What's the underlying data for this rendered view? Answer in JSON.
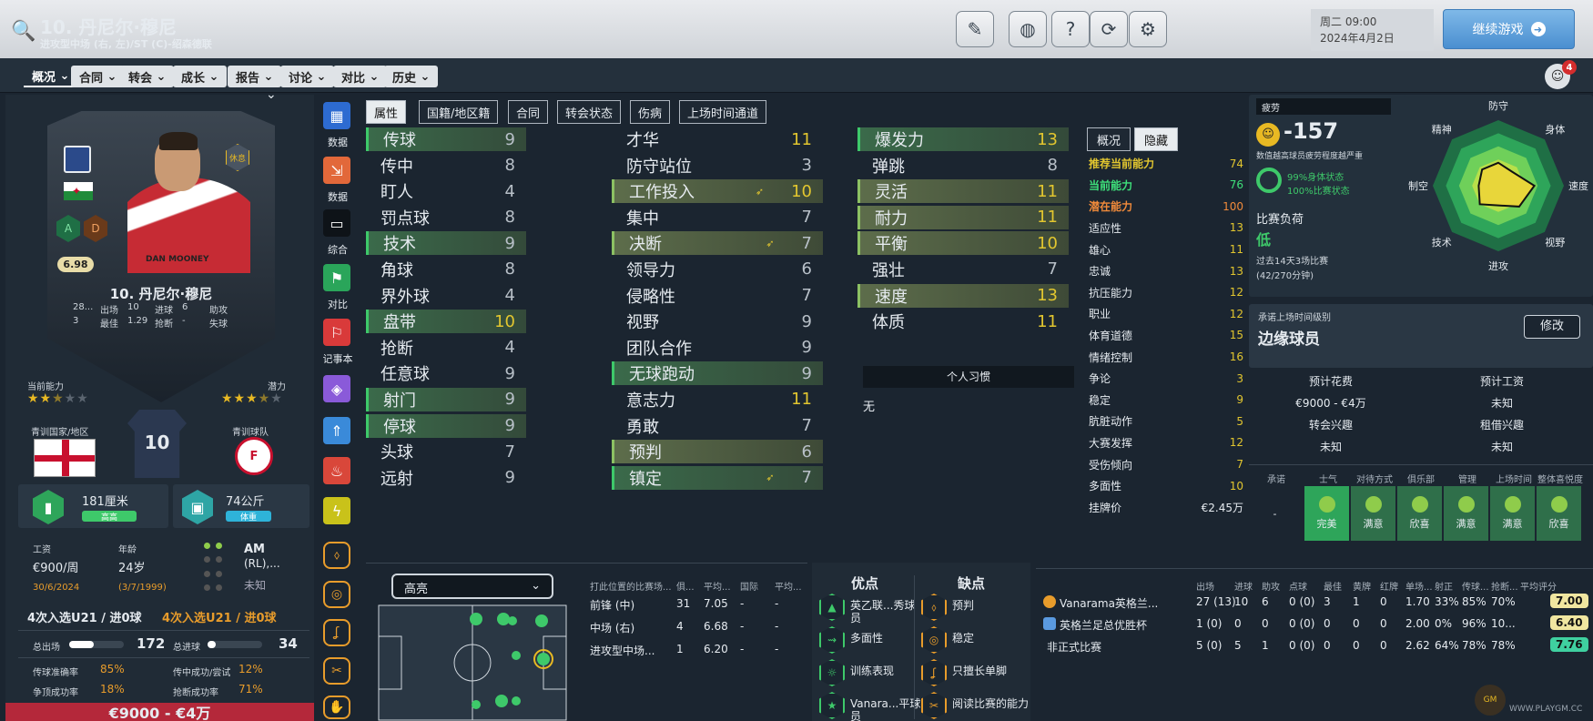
{
  "header": {
    "title": "10. 丹尼尔·穆尼",
    "subtitle": "进攻型中场 (右, 左)/ST (C)-绍森德联",
    "datetime_day": "周二 09:00",
    "datetime_date": "2024年4月2日",
    "continue_label": "继续游戏"
  },
  "nav": {
    "tabs": [
      "概况",
      "合同",
      "转会",
      "成长",
      "报告",
      "讨论",
      "对比",
      "历史"
    ],
    "notifications": "4"
  },
  "card": {
    "rest_badge": "休息",
    "rating": "6.98",
    "name": "10. 丹尼尔·穆尼",
    "jersey_name": "DAN MOONEY",
    "stats_row1": [
      "28...",
      "出场",
      "10",
      "进球",
      "6",
      "助攻"
    ],
    "stats_row2": [
      "3",
      "最佳",
      "1.29",
      "抢断",
      "-",
      "失球"
    ],
    "current_ability_label": "当前能力",
    "potential_label": "潜力",
    "current_stars": 2.5,
    "potential_stars": 3.5,
    "badge_a": "A",
    "badge_d": "D"
  },
  "profile": {
    "youth_nation_label": "青训国家/地区",
    "youth_club_label": "青训球队",
    "shirt_number": "10",
    "height": "181厘米",
    "height_tag": "高高",
    "weight": "74公斤",
    "weight_tag": "体重",
    "wage_label": "工资",
    "wage": "€900/周",
    "age_label": "年龄",
    "age": "24岁",
    "contract_end": "30/6/2024",
    "dob": "(3/7/1999)",
    "position_main": "AM",
    "position_sub": "(RL),...",
    "position_status": "未知",
    "u21_left": "4次入选U21 / 进0球",
    "u21_right": "4次入选U21 / 进0球",
    "appearances_label": "总出场",
    "appearances": "172",
    "goals_label": "总进球",
    "goals": "34",
    "pass_label": "传球准确率",
    "pass_value": "85%",
    "cross_label": "传中成功/尝试",
    "cross_value": "12%",
    "header_label": "争顶成功率",
    "header_value": "18%",
    "tackle_label": "抢断成功率",
    "tackle_value": "71%",
    "value_range": "€9000 - €4万"
  },
  "side_buttons": [
    "数据",
    "数据",
    "综合",
    "对比",
    "记事本"
  ],
  "attr_tabs": [
    "属性",
    "国籍/地区籍",
    "合同",
    "转会状态",
    "伤病",
    "上场时间通道"
  ],
  "technical": [
    {
      "name": "传球",
      "value": "9",
      "hl": "hl"
    },
    {
      "name": "传中",
      "value": "8",
      "hl": ""
    },
    {
      "name": "盯人",
      "value": "4",
      "hl": ""
    },
    {
      "name": "罚点球",
      "value": "8",
      "hl": ""
    },
    {
      "name": "技术",
      "value": "9",
      "hl": "hl"
    },
    {
      "name": "角球",
      "value": "8",
      "hl": ""
    },
    {
      "name": "界外球",
      "value": "4",
      "hl": ""
    },
    {
      "name": "盘带",
      "value": "10",
      "hl": "hl"
    },
    {
      "name": "抢断",
      "value": "4",
      "hl": ""
    },
    {
      "name": "任意球",
      "value": "9",
      "hl": ""
    },
    {
      "name": "射门",
      "value": "9",
      "hl": "hl"
    },
    {
      "name": "停球",
      "value": "9",
      "hl": "hl"
    },
    {
      "name": "头球",
      "value": "7",
      "hl": ""
    },
    {
      "name": "远射",
      "value": "9",
      "hl": ""
    }
  ],
  "mental": [
    {
      "name": "才华",
      "value": "11",
      "hl": "",
      "arrow": ""
    },
    {
      "name": "防守站位",
      "value": "3",
      "hl": "",
      "arrow": ""
    },
    {
      "name": "工作投入",
      "value": "10",
      "hl": "hl2",
      "arrow": "➶"
    },
    {
      "name": "集中",
      "value": "7",
      "hl": "",
      "arrow": ""
    },
    {
      "name": "决断",
      "value": "7",
      "hl": "hl2",
      "arrow": "➶"
    },
    {
      "name": "领导力",
      "value": "6",
      "hl": "",
      "arrow": ""
    },
    {
      "name": "侵略性",
      "value": "7",
      "hl": "",
      "arrow": ""
    },
    {
      "name": "视野",
      "value": "9",
      "hl": "",
      "arrow": ""
    },
    {
      "name": "团队合作",
      "value": "9",
      "hl": "",
      "arrow": ""
    },
    {
      "name": "无球跑动",
      "value": "9",
      "hl": "hl",
      "arrow": ""
    },
    {
      "name": "意志力",
      "value": "11",
      "hl": "",
      "arrow": ""
    },
    {
      "name": "勇敢",
      "value": "7",
      "hl": "",
      "arrow": ""
    },
    {
      "name": "预判",
      "value": "6",
      "hl": "hl2",
      "arrow": ""
    },
    {
      "name": "镇定",
      "value": "7",
      "hl": "hl",
      "arrow": "➶"
    }
  ],
  "physical": [
    {
      "name": "爆发力",
      "value": "13",
      "hl": "hl"
    },
    {
      "name": "弹跳",
      "value": "8",
      "hl": ""
    },
    {
      "name": "灵活",
      "value": "11",
      "hl": "hl2"
    },
    {
      "name": "耐力",
      "value": "11",
      "hl": "hl2"
    },
    {
      "name": "平衡",
      "value": "10",
      "hl": "hl2"
    },
    {
      "name": "强壮",
      "value": "7",
      "hl": ""
    },
    {
      "name": "速度",
      "value": "13",
      "hl": "hl2"
    },
    {
      "name": "体质",
      "value": "11",
      "hl": ""
    }
  ],
  "habits": {
    "title": "个人习惯",
    "value": "无"
  },
  "hidden": {
    "tabs": [
      "概况",
      "隐藏"
    ],
    "rows": [
      {
        "name": "推荐当前能力",
        "value": "74",
        "color": "#e2c62f"
      },
      {
        "name": "当前能力",
        "value": "76",
        "color": "#3ee07a"
      },
      {
        "name": "潜在能力",
        "value": "100",
        "color": "#f08a3a"
      },
      {
        "name": "适应性",
        "value": "13",
        "color": ""
      },
      {
        "name": "雄心",
        "value": "11",
        "color": ""
      },
      {
        "name": "忠诚",
        "value": "13",
        "color": ""
      },
      {
        "name": "抗压能力",
        "value": "12",
        "color": ""
      },
      {
        "name": "职业",
        "value": "12",
        "color": ""
      },
      {
        "name": "体育道德",
        "value": "15",
        "color": ""
      },
      {
        "name": "情绪控制",
        "value": "16",
        "color": ""
      },
      {
        "name": "争论",
        "value": "3",
        "color": ""
      },
      {
        "name": "稳定",
        "value": "9",
        "color": ""
      },
      {
        "name": "肮脏动作",
        "value": "5",
        "color": ""
      },
      {
        "name": "大赛发挥",
        "value": "12",
        "color": ""
      },
      {
        "name": "受伤倾向",
        "value": "7",
        "color": ""
      },
      {
        "name": "多面性",
        "value": "10",
        "color": ""
      },
      {
        "name": "挂牌价",
        "value": "€2.45万",
        "color": ""
      }
    ]
  },
  "fatigue": {
    "label": "疲劳",
    "value": "-157",
    "desc": "数值越高球员疲劳程度越严重",
    "body": "99%身体状态",
    "match": "100%比赛状态",
    "load_label": "比赛负荷",
    "load_value": "低",
    "load_desc1": "过去14天3场比赛",
    "load_desc2": "(42/270分钟)"
  },
  "radar": {
    "labels": [
      "防守",
      "身体",
      "速度",
      "视野",
      "进攻",
      "技术",
      "制空",
      "精神"
    ],
    "values": [
      0.35,
      0.3,
      0.55,
      0.45,
      0.3,
      0.4,
      0.3,
      0.35
    ]
  },
  "playtime": {
    "label": "承诺上场时间级别",
    "value": "边缘球员",
    "edit": "修改",
    "exp_fee_label": "预计花费",
    "exp_wage_label": "预计工资",
    "exp_fee": "€9000 - €4万",
    "exp_wage": "未知",
    "transfer_label": "转会兴趣",
    "loan_label": "租借兴趣",
    "transfer": "未知",
    "loan": "未知"
  },
  "mood": {
    "headers": [
      "承诺",
      "士气",
      "对待方式",
      "俱乐部",
      "管理",
      "上场时间",
      "整体喜悦度"
    ],
    "values": [
      "-",
      "完美",
      "满意",
      "欣喜",
      "满意",
      "满意",
      "欣喜"
    ]
  },
  "highlights": {
    "select": "高亮",
    "tbl_headers": [
      "打此位置的比赛场...",
      "俱...",
      "平均...",
      "国际",
      "平均..."
    ],
    "rows": [
      [
        "前锋 (中)",
        "31",
        "7.05",
        "-",
        "-"
      ],
      [
        "中场 (右)",
        "4",
        "6.68",
        "-",
        "-"
      ],
      [
        "进攻型中场...",
        "1",
        "6.20",
        "-",
        "-"
      ]
    ]
  },
  "traits": {
    "pros_title": "优点",
    "cons_title": "缺点",
    "pros": [
      "英乙联...秀球员",
      "多面性",
      "训练表现",
      "Vanara...平球员"
    ],
    "cons": [
      "预判",
      "稳定",
      "只擅长单脚",
      "阅读比赛的能力"
    ]
  },
  "career": {
    "headers": [
      "出场",
      "进球",
      "助攻",
      "点球",
      "最佳",
      "黄牌",
      "红牌",
      "单场...",
      "射正",
      "传球...",
      "抢断...",
      "平均评分"
    ],
    "rows": [
      {
        "comp": "Vanarama英格兰...",
        "vals": [
          "27 (13)",
          "10",
          "6",
          "0 (0)",
          "3",
          "1",
          "0",
          "1.70",
          "33%",
          "85%",
          "70%"
        ],
        "rating": "7.00",
        "rcolor": "#f0e6a0"
      },
      {
        "comp": "英格兰足总优胜杯",
        "vals": [
          "1 (0)",
          "0",
          "0",
          "0 (0)",
          "0",
          "0",
          "0",
          "2.00",
          "0%",
          "96%",
          "10..."
        ],
        "rating": "6.40",
        "rcolor": "#f0e6a0"
      },
      {
        "comp": "非正式比赛",
        "vals": [
          "5 (0)",
          "5",
          "1",
          "0 (0)",
          "0",
          "0",
          "0",
          "2.62",
          "64%",
          "78%",
          "78%"
        ],
        "rating": "7.76",
        "rcolor": "#3fd0a0"
      }
    ]
  },
  "watermark": "WWW.PLAYGM.CC",
  "colors": {
    "green": "#3ec96a",
    "yellow": "#e2c62f",
    "orange": "#e89c2b"
  }
}
